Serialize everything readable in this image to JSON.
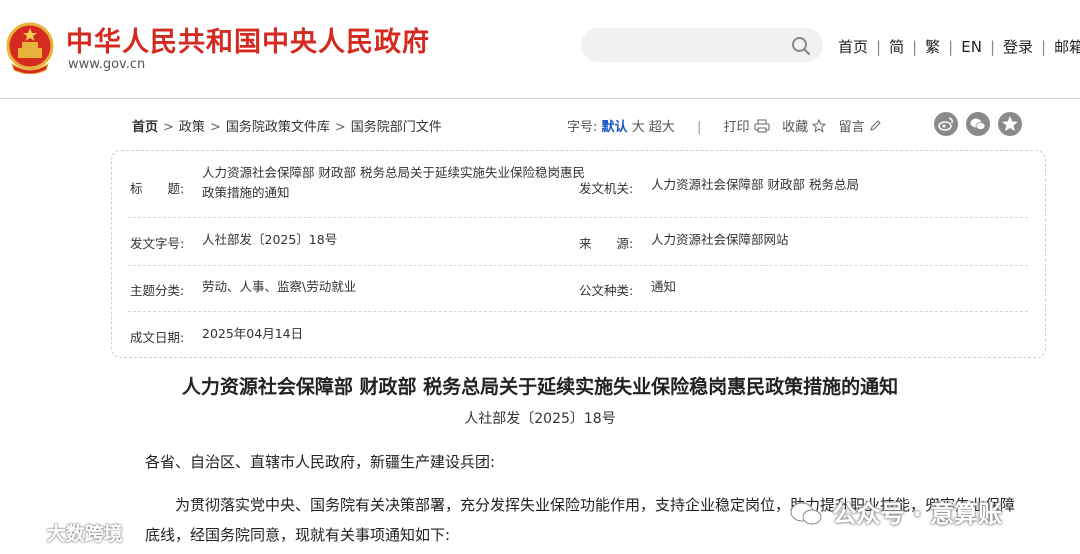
{
  "header": {
    "site_title": "中华人民共和国中央人民政府",
    "site_url": "www.gov.cn",
    "links": [
      "首页",
      "简",
      "繁",
      "EN",
      "登录",
      "邮箱"
    ]
  },
  "breadcrumb": {
    "home": "首页",
    "items": [
      "政策",
      "国务院政策文件库",
      "国务院部门文件"
    ],
    "separator": ">"
  },
  "tools": {
    "font_label": "字号:",
    "font_default": "默认",
    "font_large": "大",
    "font_xlarge": "超大",
    "print": "打印",
    "favorite": "收藏",
    "comment": "留言"
  },
  "info": {
    "title_label": "标　　题:",
    "title_value": "人力资源社会保障部 财政部 税务总局关于延续实施失业保险稳岗惠民政策措施的通知",
    "issuer_label": "发文机关:",
    "issuer_value": "人力资源社会保障部 财政部 税务总局",
    "docno_label": "发文字号:",
    "docno_value": "人社部发〔2025〕18号",
    "source_label": "来　　源:",
    "source_value": "人力资源社会保障部网站",
    "topic_label": "主题分类:",
    "topic_value": "劳动、人事、监察\\劳动就业",
    "type_label": "公文种类:",
    "type_value": "通知",
    "date_label": "成文日期:",
    "date_value": "2025年04月14日"
  },
  "article": {
    "title": "人力资源社会保障部 财政部 税务总局关于延续实施失业保险稳岗惠民政策措施的通知",
    "doc_number": "人社部发〔2025〕18号",
    "salutation": "各省、自治区、直辖市人民政府，新疆生产建设兵团:",
    "paragraph1": "为贯彻落实党中央、国务院有关决策部署，充分发挥失业保险功能作用，支持企业稳定岗位，助力提升职业技能，兜牢失业保障底线，经国务院同意，现就有关事项通知如下:"
  },
  "watermarks": {
    "left": "大数跨境",
    "right": "公众号 · 意算账"
  },
  "colors": {
    "brand_red": "#d52a1f",
    "accent_blue": "#1a56c5"
  }
}
